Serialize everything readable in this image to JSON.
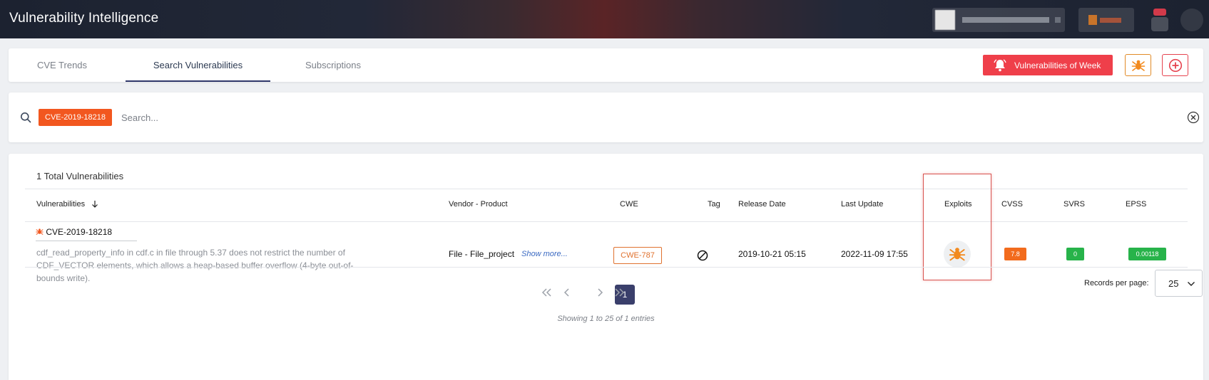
{
  "app": {
    "title": "Vulnerability Intelligence"
  },
  "tabs": [
    {
      "label": "CVE Trends"
    },
    {
      "label": "Search Vulnerabilities"
    },
    {
      "label": "Subscriptions"
    }
  ],
  "actions": {
    "vulnerabilities_of_week": "Vulnerabilities of Week"
  },
  "search": {
    "chip": "CVE-2019-18218",
    "placeholder": "Search..."
  },
  "results": {
    "total": "1 Total Vulnerabilities",
    "headers": {
      "vulnerabilities": "Vulnerabilities",
      "vendor_product": "Vendor - Product",
      "cwe": "CWE",
      "tag": "Tag",
      "release_date": "Release Date",
      "last_update": "Last Update",
      "exploits": "Exploits",
      "cvss": "CVSS",
      "svrs": "SVRS",
      "epss": "EPSS"
    },
    "rows": [
      {
        "id": "CVE-2019-18218",
        "description": "cdf_read_property_info in cdf.c in file through 5.37 does not restrict the number of CDF_VECTOR elements, which allows a heap-based buffer overflow (4-byte out-of-bounds write).",
        "vendor_product": "File - File_project",
        "show_more": "Show more...",
        "cwe": "CWE-787",
        "release_date": "2019-10-21 05:15",
        "last_update": "2022-11-09 17:55",
        "cvss": "7.8",
        "svrs": "0",
        "epss": "0.00118"
      }
    ]
  },
  "pagination": {
    "current": "1",
    "showing": "Showing 1 to 25 of 1 entries",
    "records_per_page_label": "Records per page:",
    "records_per_page": "25"
  },
  "colors": {
    "accent_red": "#ef3f4a",
    "accent_orange": "#f2571f",
    "cvss_high": "#f26b1d",
    "score_green": "#27b34a",
    "primary_navy": "#3a3f6b"
  },
  "icons": [
    "search-icon",
    "bug-icon",
    "bell-icon",
    "plus-circle-icon",
    "clear-icon",
    "ban-icon",
    "sort-down-icon",
    "chevron-down-icon"
  ]
}
